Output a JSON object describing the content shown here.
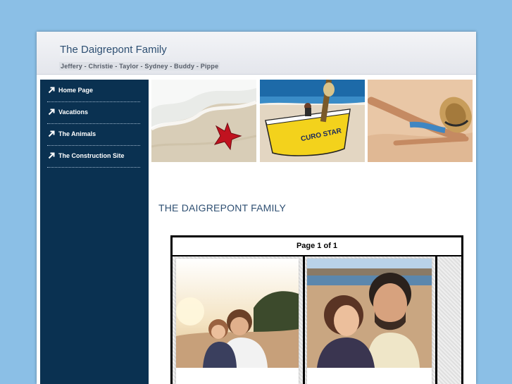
{
  "site": {
    "title": "The Daigrepont Family",
    "tagline": "Jeffery - Christie - Taylor - Sydney - Buddy - Pippe"
  },
  "nav": {
    "items": [
      {
        "label": "Home Page",
        "icon": "arrow-up-right-icon"
      },
      {
        "label": "Vacations",
        "icon": "arrow-up-right-icon"
      },
      {
        "label": "The Animals",
        "icon": "arrow-up-right-icon"
      },
      {
        "label": "The Construction Site",
        "icon": "arrow-up-right-icon"
      }
    ]
  },
  "banner": {
    "boat_text": "CURO STAR"
  },
  "main": {
    "heading": "THE DAIGREPONT FAMILY"
  },
  "gallery": {
    "pager": "Page 1 of 1"
  },
  "colors": {
    "page_background": "#8bbfe6",
    "sidebar": "#0a3151",
    "title_text": "#2e4f72"
  }
}
